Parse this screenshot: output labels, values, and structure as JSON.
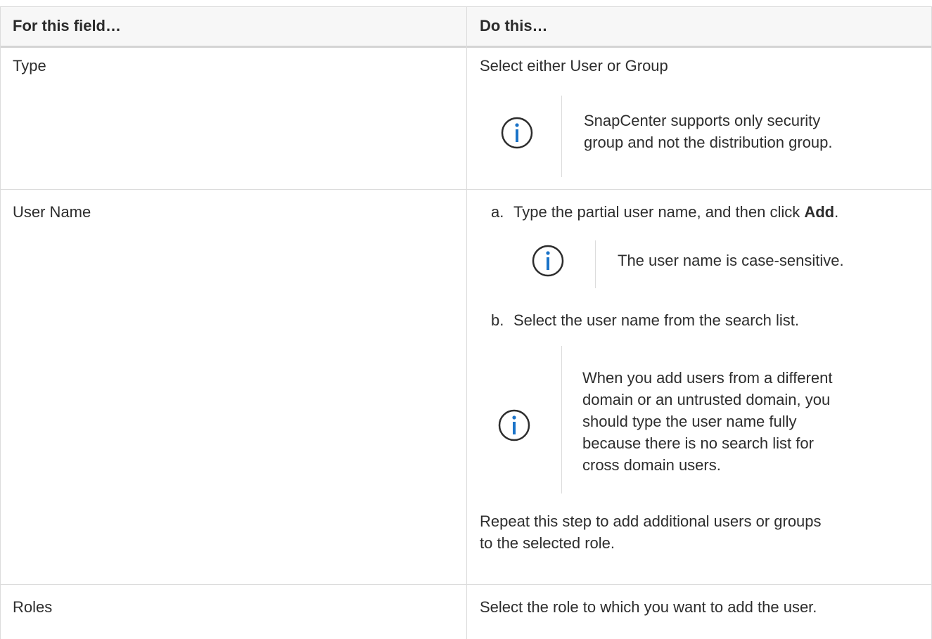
{
  "table": {
    "headers": {
      "field": "For this field…",
      "action": "Do this…"
    },
    "rows": [
      {
        "field": "Type",
        "action": "Select either User or Group",
        "note": "SnapCenter supports only security group and not the distribution group.",
        "note_lines": [
          "SnapCenter supports only security",
          "group and not the distribution group."
        ]
      },
      {
        "field": "User Name",
        "steps": [
          {
            "marker": "a.",
            "text_before": "Type the partial user name, and then click ",
            "text_bold": "Add",
            "text_after": ".",
            "note": "The user name is case-sensitive."
          },
          {
            "marker": "b.",
            "text": "Select the user name from the search list.",
            "note_lines": [
              "When you add users from a different",
              "domain or an untrusted domain, you",
              "should type the user name fully",
              "because there is no search list for",
              "cross domain users."
            ]
          }
        ],
        "footer_lines": [
          "Repeat this step to add additional users or groups",
          "to the selected role."
        ]
      },
      {
        "field": "Roles",
        "action": "Select the role to which you want to add the user."
      }
    ]
  },
  "colors": {
    "info_icon": "#1a73c8",
    "border": "#dcdcdc",
    "header_bg": "#f7f7f7"
  },
  "icons": {
    "info": "info-icon"
  }
}
